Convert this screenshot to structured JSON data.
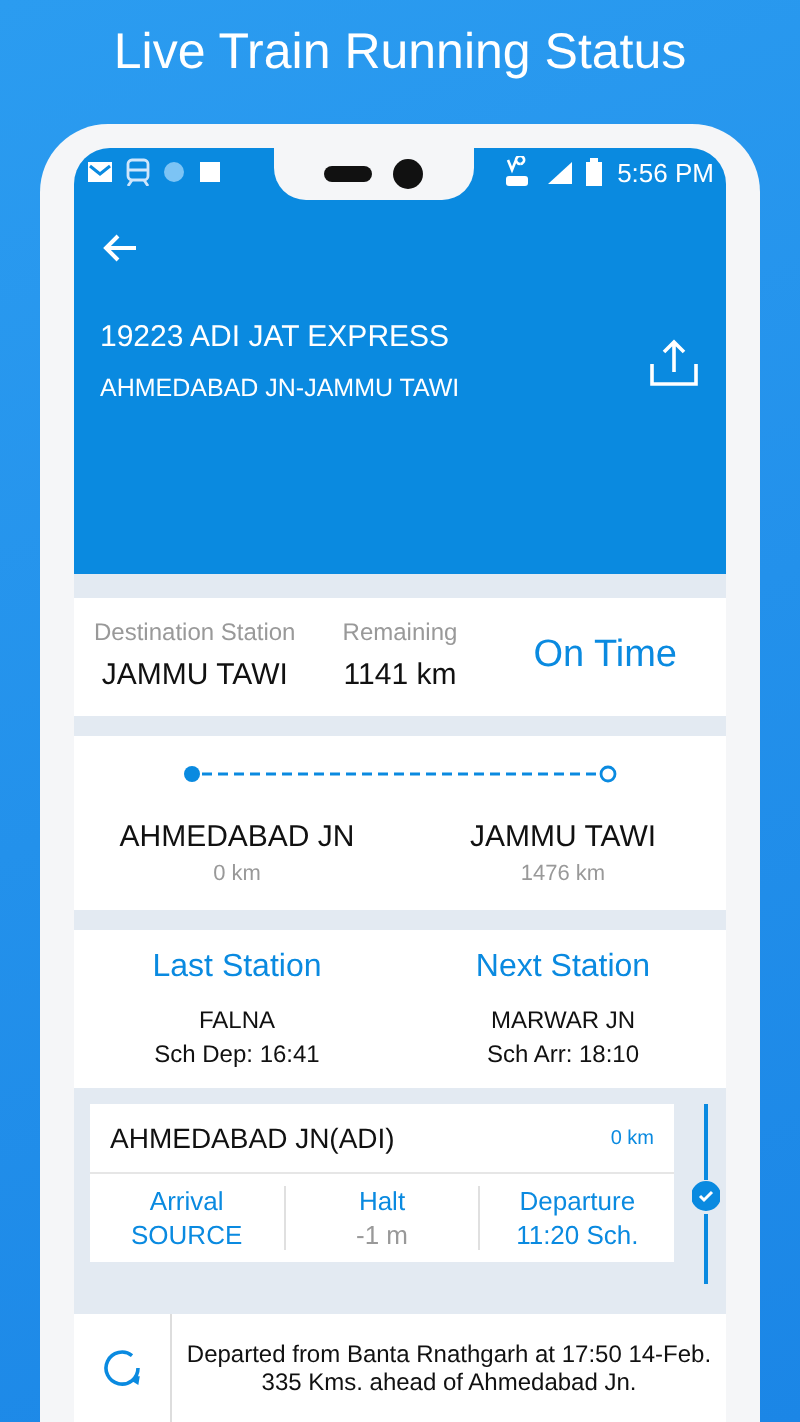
{
  "headline": "Live Train Running Status",
  "status_bar": {
    "time": "5:56 PM"
  },
  "header": {
    "train": "19223 ADI JAT EXPRESS",
    "route": "AHMEDABAD JN-JAMMU TAWI"
  },
  "summary": {
    "destination_label": "Destination Station",
    "destination": "JAMMU TAWI",
    "remaining_label": "Remaining",
    "remaining": "1141 km",
    "status": "On Time"
  },
  "journey": {
    "from": {
      "name": "AHMEDABAD JN",
      "distance": "0 km"
    },
    "to": {
      "name": "JAMMU TAWI",
      "distance": "1476 km"
    }
  },
  "stations": [
    {
      "label": "Last Station",
      "name": "FALNA",
      "time": "Sch Dep: 16:41"
    },
    {
      "label": "Next Station",
      "name": "MARWAR JN",
      "time": "Sch Arr: 18:10"
    }
  ],
  "stop": {
    "name": "AHMEDABAD JN(ADI)",
    "distance": "0 km",
    "passed": true,
    "columns": [
      {
        "label": "Arrival",
        "value": "SOURCE",
        "kind": "accent"
      },
      {
        "label": "Halt",
        "value": "-1 m",
        "kind": "muted"
      },
      {
        "label": "Departure",
        "value": "11:20 Sch.",
        "kind": "accent"
      }
    ]
  },
  "update": {
    "message": "Departed from Banta Rnathgarh at 17:50 14-Feb. 335 Kms. ahead of Ahmedabad Jn."
  }
}
